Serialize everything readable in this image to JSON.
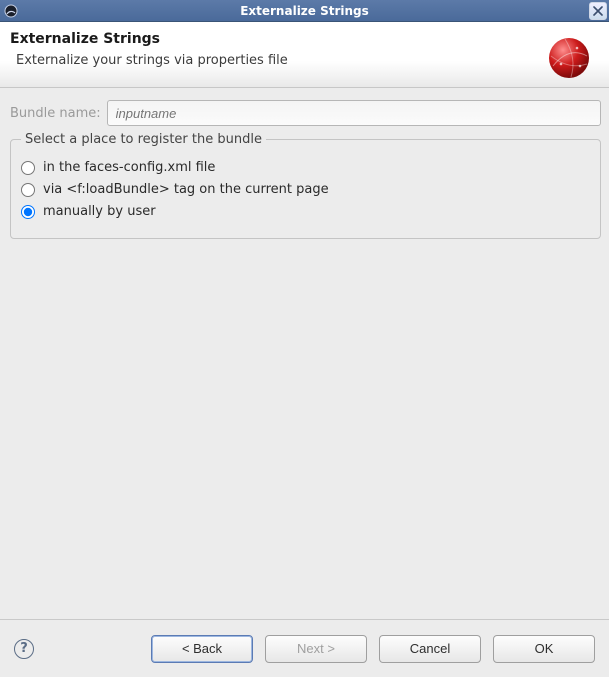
{
  "titlebar": {
    "title": "Externalize Strings"
  },
  "header": {
    "title": "Externalize Strings",
    "subtitle": "Externalize your strings via properties file"
  },
  "bundle": {
    "label": "Bundle name:",
    "placeholder": "inputname",
    "value": ""
  },
  "group": {
    "legend": "Select a place to register the bundle",
    "options": [
      {
        "id": "opt-faces",
        "label": "in the faces-config.xml file",
        "checked": false
      },
      {
        "id": "opt-load",
        "label": "via <f:loadBundle> tag on the current page",
        "checked": false
      },
      {
        "id": "opt-manual",
        "label": "manually by user",
        "checked": true
      }
    ]
  },
  "buttons": {
    "back": "< Back",
    "next": "Next >",
    "cancel": "Cancel",
    "ok": "OK"
  }
}
